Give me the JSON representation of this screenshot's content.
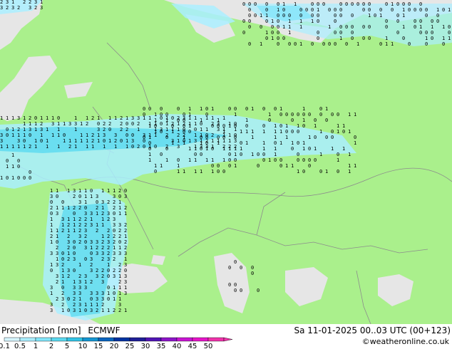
{
  "footer": {
    "title": "Precipitation [mm]",
    "model": "ECMWF",
    "datetime": "Sa 11-01-2025 00..03 UTC (00+123)",
    "credit": "©weatheronline.co.uk"
  },
  "legend": {
    "labels": [
      "0.1",
      "0.5",
      "1",
      "2",
      "5",
      "10",
      "15",
      "20",
      "25",
      "30",
      "35",
      "40",
      "45",
      "50"
    ],
    "colors": [
      "#d6f5ff",
      "#aaeeff",
      "#82e6fa",
      "#5ad9f0",
      "#32c4e6",
      "#1496d2",
      "#0a64be",
      "#0032a0",
      "#1e1e96",
      "#5014b4",
      "#8c14c8",
      "#c814d2",
      "#e614c8",
      "#f032aa"
    ]
  },
  "map_colors": {
    "sea": "#e6e6e6",
    "land": "#aaf08c",
    "precip_light": "#aaeeff",
    "precip_mid": "#5ad9f0"
  }
}
